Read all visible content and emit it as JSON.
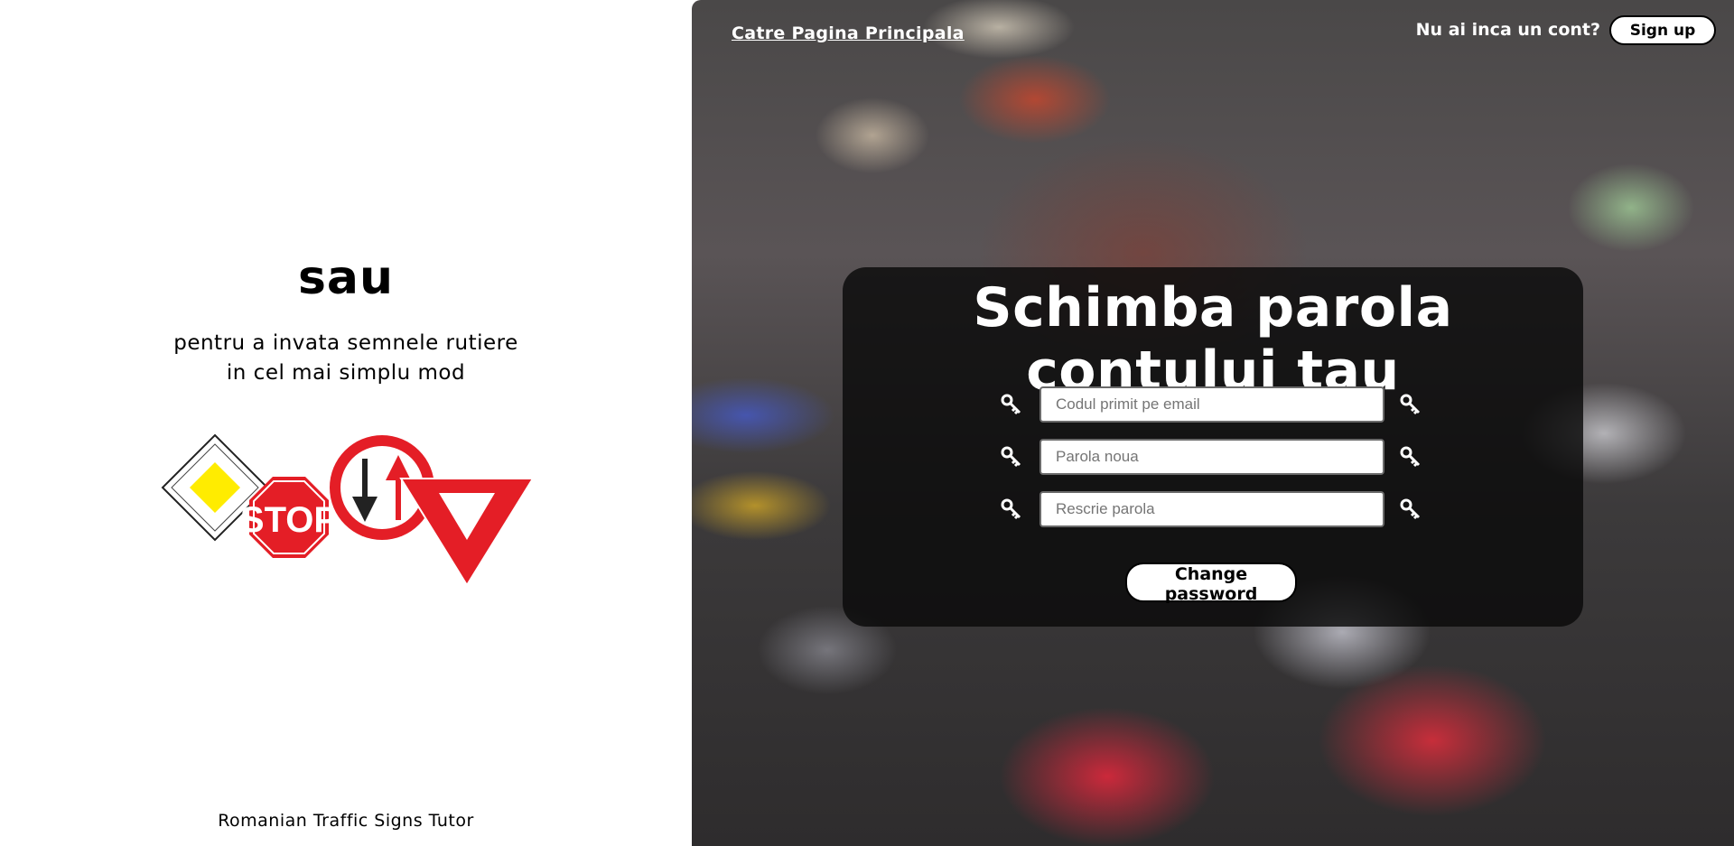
{
  "left_panel": {
    "or_text": "sau",
    "tagline_line1": "pentru a invata semnele rutiere",
    "tagline_line2": "in cel mai simplu mod",
    "signs_illustration": {
      "icons": [
        "priority-road-sign-icon",
        "stop-sign-icon",
        "priority-oncoming-sign-icon",
        "yield-sign-icon"
      ],
      "stop_text": "STOP"
    },
    "footer_title": "Romanian Traffic Signs Tutor"
  },
  "header": {
    "home_link": "Catre Pagina Principala",
    "signup_prompt": "Nu ai inca un cont?",
    "signup_button": "Sign up"
  },
  "form": {
    "title": "Schimba parola contului tau",
    "fields": [
      {
        "placeholder": "Codul primit pe email",
        "value": ""
      },
      {
        "placeholder": "Parola noua",
        "value": ""
      },
      {
        "placeholder": "Rescrie parola",
        "value": ""
      }
    ],
    "submit_label": "Change password"
  },
  "colors": {
    "card_background": "#0a0a0a",
    "sign_red": "#e41e26",
    "sign_yellow": "#ffec00"
  }
}
